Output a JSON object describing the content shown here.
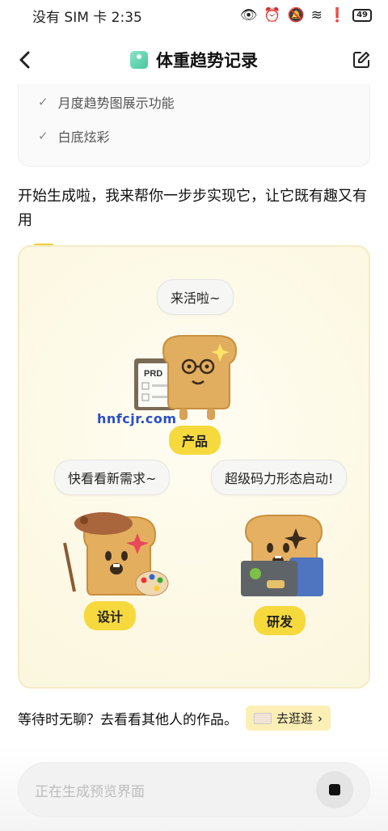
{
  "status_bar": {
    "carrier_time": "没有 SIM 卡 2:35",
    "battery": "49"
  },
  "header": {
    "title": "体重趋势记录"
  },
  "features": [
    "月度趋势图展示功能",
    "白底炫彩"
  ],
  "intro": "开始生成啦，我来帮你一步步实现它，让它既有趣又有用",
  "preview": {
    "bubble_top": "来活啦~",
    "bubble_left": "快看看新需求~",
    "bubble_right": "超级码力形态启动!",
    "tag_product": "产品",
    "tag_design": "设计",
    "tag_dev": "研发",
    "prd_label": "PRD"
  },
  "watermark": "hnfcjr.com",
  "footer": {
    "wait_text": "等待时无聊？去看看其他人的作品。",
    "browse_label": "去逛逛"
  },
  "input": {
    "placeholder": "正在生成预览界面"
  }
}
